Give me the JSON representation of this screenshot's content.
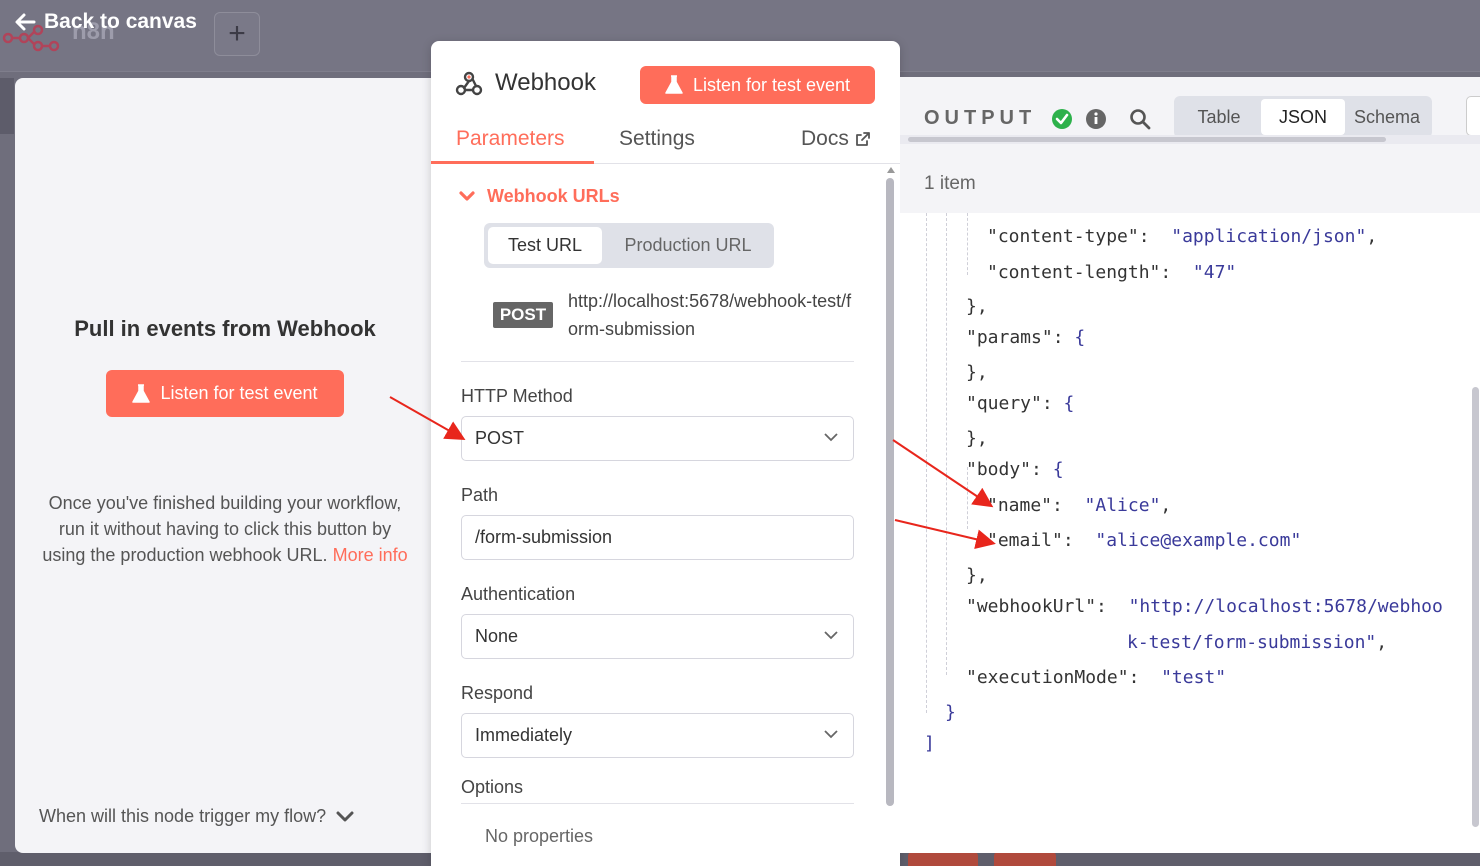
{
  "topbar": {
    "back_label": "Back to canvas",
    "app_name": "n8n"
  },
  "left_panel": {
    "title": "Pull in events from Webhook",
    "listen_button": "Listen for test event",
    "info_text": "Once you've finished building your workflow, run it without having to click this button by using the production webhook URL.",
    "more_info_link": "More info",
    "trigger_question": "When will this node trigger my flow?"
  },
  "node": {
    "title": "Webhook",
    "listen_button": "Listen for test event",
    "tabs": {
      "parameters": "Parameters",
      "settings": "Settings",
      "docs": "Docs"
    },
    "webhook_urls_section": "Webhook URLs",
    "url_toggle": {
      "test": "Test URL",
      "production": "Production URL"
    },
    "method_badge": "POST",
    "url": "http://localhost:5678/webhook-test/form-submission",
    "fields": {
      "http_method": {
        "label": "HTTP Method",
        "value": "POST"
      },
      "path": {
        "label": "Path",
        "value": "/form-submission"
      },
      "authentication": {
        "label": "Authentication",
        "value": "None"
      },
      "respond": {
        "label": "Respond",
        "value": "Immediately"
      }
    },
    "options_label": "Options",
    "no_properties": "No properties"
  },
  "output": {
    "label": "OUTPUT",
    "views": {
      "table": "Table",
      "json": "JSON",
      "schema": "Schema"
    },
    "selected_view": "JSON",
    "items_count": "1 item",
    "json": {
      "content_type_key": "\"content-type\"",
      "content_type_val": "\"application/json\"",
      "content_length_key": "\"content-length\"",
      "content_length_val": "\"47\"",
      "params_key": "\"params\"",
      "query_key": "\"query\"",
      "body_key": "\"body\"",
      "name_key": "\"name\"",
      "name_val": "\"Alice\"",
      "email_key": "\"email\"",
      "email_val": "\"alice@example.com\"",
      "webhook_url_key": "\"webhookUrl\"",
      "webhook_url_val_1": "\"http://localhost:5678/webhoo",
      "webhook_url_val_2": "k-test/form-submission\"",
      "execution_mode_key": "\"executionMode\"",
      "execution_mode_val": "\"test\""
    }
  },
  "colors": {
    "accent": "#ff6d5a",
    "json_string": "#3a3a9a",
    "success": "#2db14b",
    "arrow": "#e8261c"
  }
}
